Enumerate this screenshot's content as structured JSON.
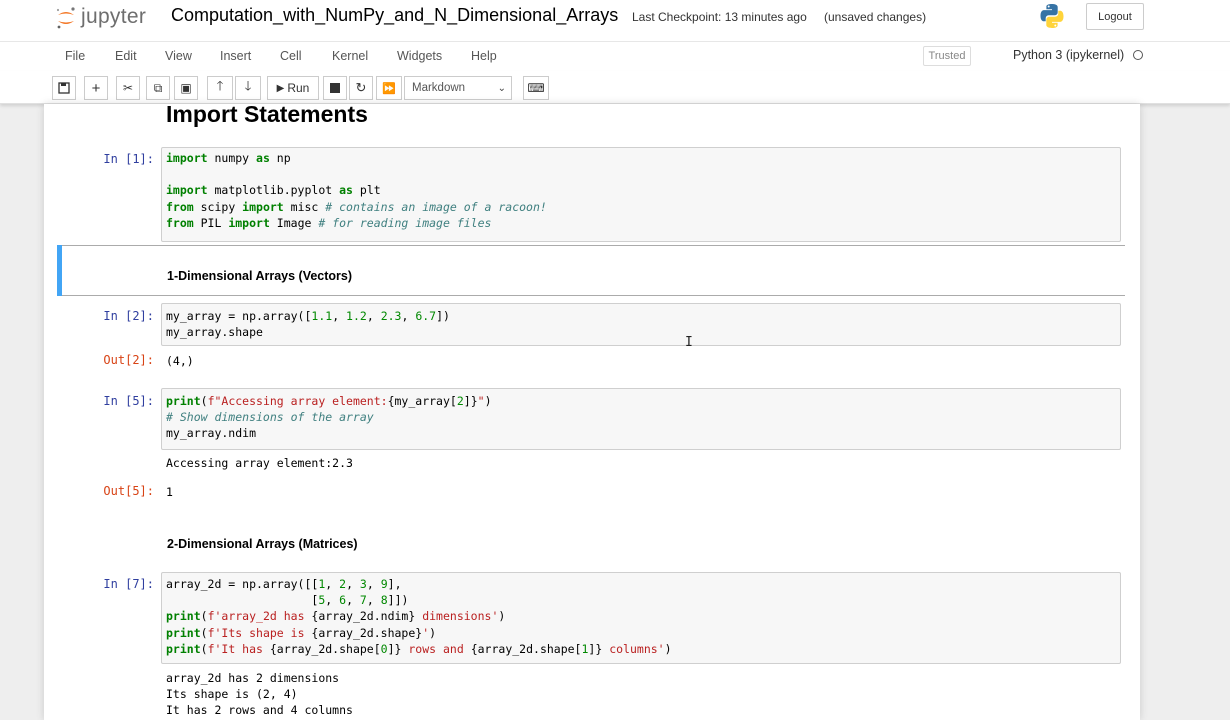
{
  "header": {
    "logo_text": "jupyter",
    "notebook_name": "Computation_with_NumPy_and_N_Dimensional_Arrays",
    "checkpoint": "Last Checkpoint: 13 minutes ago",
    "unsaved": "(unsaved changes)",
    "logout_label": "Logout"
  },
  "menubar": {
    "items": [
      "File",
      "Edit",
      "View",
      "Insert",
      "Cell",
      "Kernel",
      "Widgets",
      "Help"
    ],
    "trusted": "Trusted",
    "kernel": "Python 3 (ipykernel)"
  },
  "toolbar": {
    "run_label": "Run",
    "cell_type": "Markdown"
  },
  "cells": {
    "heading": "Import Statements",
    "in1_prompt": "In [1]:",
    "in1_lines": [
      "import numpy as np",
      "",
      "import matplotlib.pyplot as plt",
      "from scipy import misc # contains an image of a racoon!",
      "from PIL import Image # for reading image files"
    ],
    "md1": "1-Dimensional Arrays (Vectors)",
    "in2_prompt": "In [2]:",
    "in2_lines": [
      "my_array = np.array([1.1, 1.2, 2.3, 6.7])",
      "my_array.shape"
    ],
    "out2_prompt": "Out[2]:",
    "out2_text": "(4,)",
    "in5_prompt": "In [5]:",
    "in5_lines": [
      "print(f\"Accessing array element:{my_array[2]}\")",
      "# Show dimensions of the array",
      "my_array.ndim"
    ],
    "stdout5": "Accessing array element:2.3",
    "out5_prompt": "Out[5]:",
    "out5_text": "1",
    "md2": "2-Dimensional Arrays (Matrices)",
    "in7_prompt": "In [7]:",
    "in7_lines": [
      "array_2d = np.array([[1, 2, 3, 9],",
      "                     [5, 6, 7, 8]])",
      "print(f'array_2d has {array_2d.ndim} dimensions')",
      "print(f'Its shape is {array_2d.shape}')",
      "print(f'It has {array_2d.shape[0]} rows and {array_2d.shape[1]} columns')"
    ],
    "stdout7": [
      "array_2d has 2 dimensions",
      "Its shape is (2, 4)",
      "It has 2 rows and 4 columns"
    ]
  },
  "colors": {
    "prompt_in": "#303f9f",
    "prompt_out": "#d84315",
    "selected_bar": "#42a5f5",
    "logo_orange": "#f37726"
  }
}
